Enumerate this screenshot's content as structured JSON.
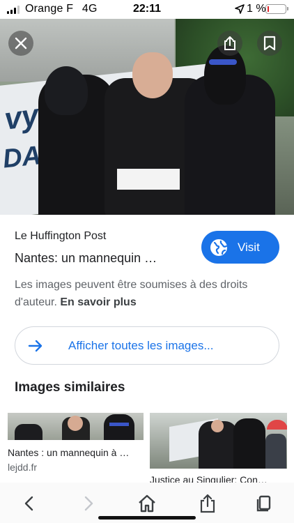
{
  "status_bar": {
    "carrier": "Orange F",
    "network": "4G",
    "time": "22:11",
    "battery_percent": "1 %",
    "battery_level": 0.01,
    "battery_color": "#e0262a"
  },
  "hero": {
    "close_icon": "close-icon",
    "share_icon": "share-icon",
    "bookmark_icon": "bookmark-icon"
  },
  "result": {
    "source": "Le Huffington Post",
    "title": "Nantes: un mannequin …",
    "visit_label": "Visit",
    "visit_icon": "globe-icon",
    "accent_color": "#1a73e8"
  },
  "copyright": {
    "text": "Les images peuvent être soumises à des droits d'auteur.",
    "link": "En savoir plus"
  },
  "all_images": {
    "label": "Afficher toutes les images...",
    "icon": "arrow-right-icon"
  },
  "similar": {
    "heading": "Images similaires",
    "items": [
      {
        "title": "Nantes : un mannequin à …",
        "site": "lejdd.fr"
      },
      {
        "title": "Justice au Singulier: Con…",
        "site": ""
      }
    ]
  },
  "toolbar": {
    "icons": [
      "back-icon",
      "forward-icon",
      "home-icon",
      "share-icon",
      "tabs-icon"
    ]
  }
}
